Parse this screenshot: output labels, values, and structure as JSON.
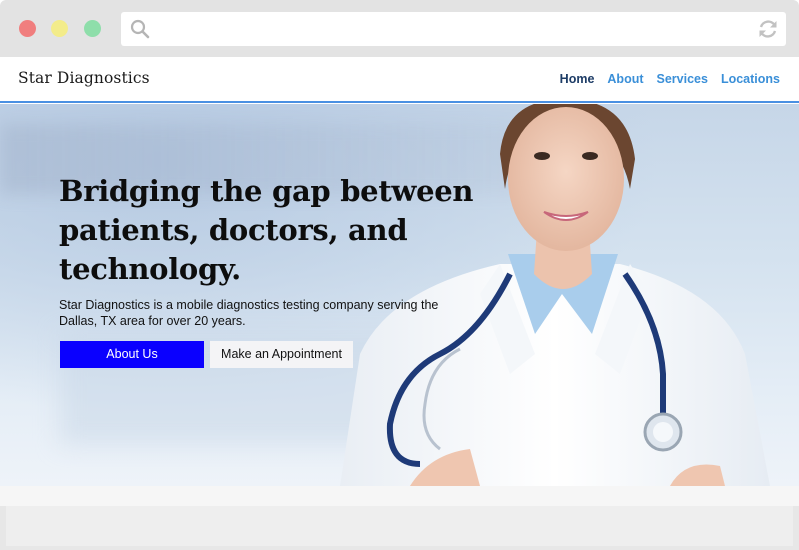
{
  "browser": {
    "search_icon": "search-icon",
    "refresh_icon": "refresh-icon",
    "address_value": ""
  },
  "header": {
    "brand": "Star Diagnostics",
    "nav": [
      {
        "label": "Home",
        "active": true
      },
      {
        "label": "About",
        "active": false
      },
      {
        "label": "Services",
        "active": false
      },
      {
        "label": "Locations",
        "active": false
      }
    ]
  },
  "hero": {
    "headline_lines": [
      "Bridging the gap between",
      "patients, doctors, and",
      "technology."
    ],
    "subtext": "Star Diagnostics is a mobile diagnostics testing company serving the Dallas, TX area for over 20 years.",
    "about_button": "About Us",
    "appointment_button": "Make an Appointment"
  },
  "colors": {
    "primary_button": "#0a00ff",
    "nav_link": "#3a8fd8",
    "nav_active": "#1d3c66",
    "header_border": "#4a90e2"
  }
}
